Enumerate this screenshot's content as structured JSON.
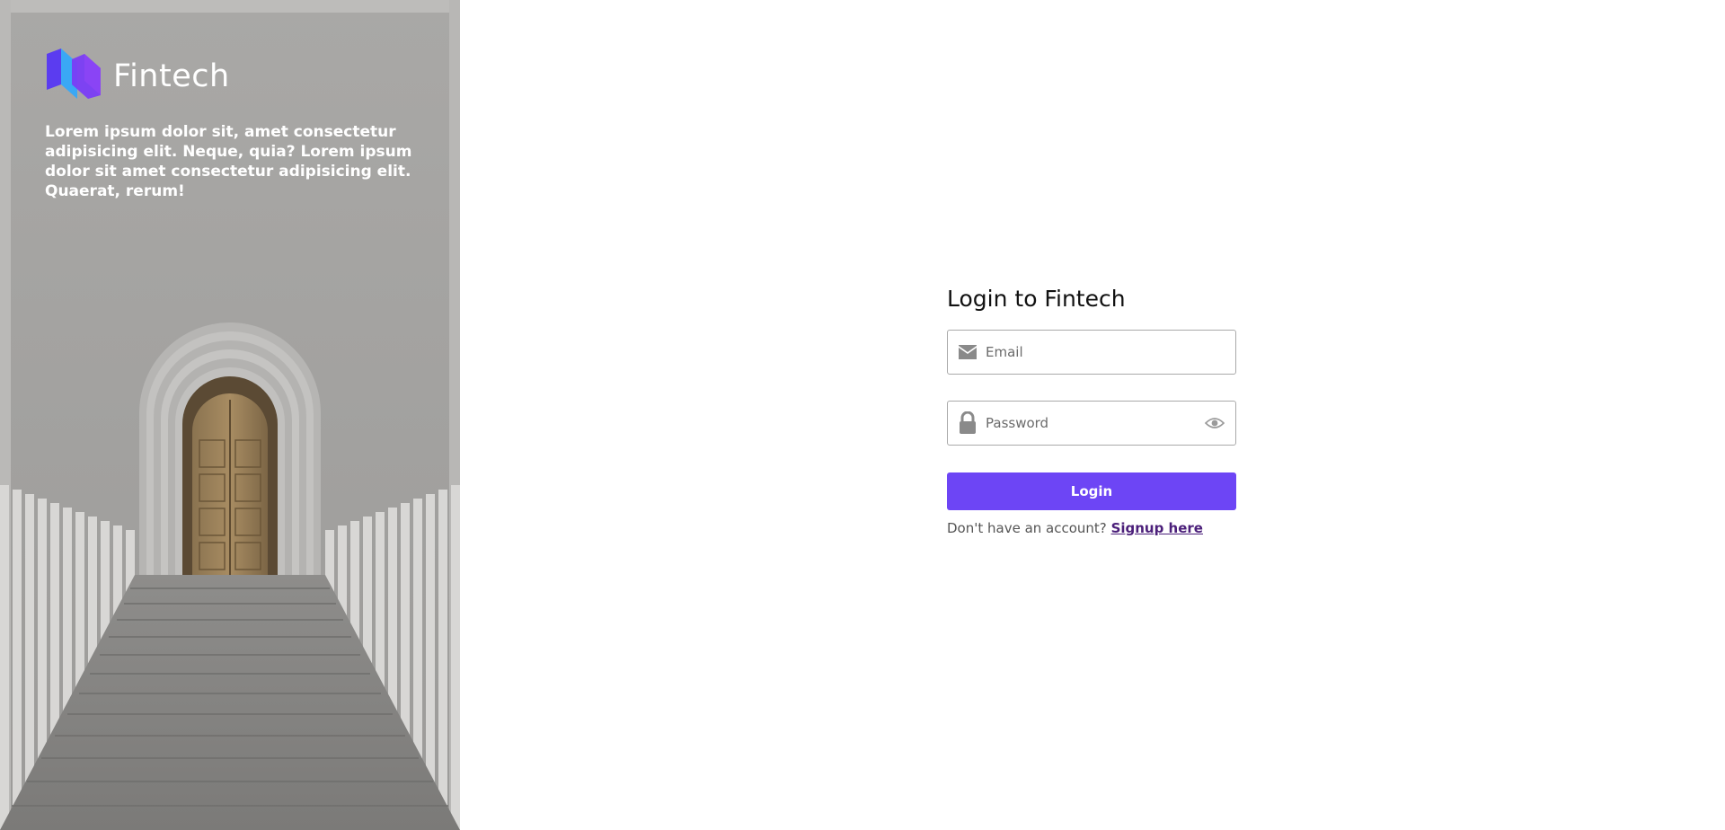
{
  "brand": {
    "name": "Fintech",
    "logo_colors": [
      "#5b3cf0",
      "#3aa8f5",
      "#7a3cf5"
    ]
  },
  "hero": {
    "text": "Lorem ipsum dolor sit, amet consectetur adipisicing elit. Neque, quia? Lorem ipsum dolor sit amet consectetur adipisicing elit. Quaerat, rerum!"
  },
  "form": {
    "title": "Login to Fintech",
    "email": {
      "placeholder": "Email",
      "value": "",
      "icon": "envelope-icon"
    },
    "password": {
      "placeholder": "Password",
      "value": "",
      "icon": "lock-icon",
      "toggle_icon": "eye-icon"
    },
    "submit_label": "Login",
    "signup_prompt": "Don't have an account?",
    "signup_link": "Signup here"
  },
  "colors": {
    "accent": "#6d45f5",
    "link": "#4b1f7a"
  }
}
